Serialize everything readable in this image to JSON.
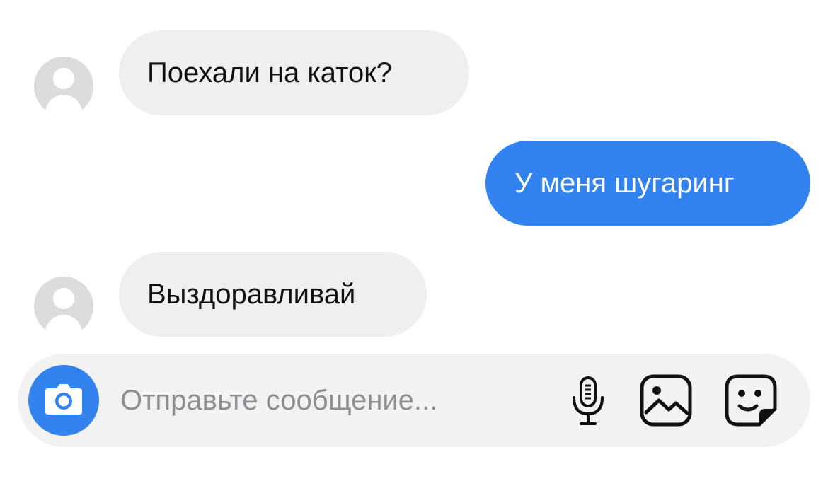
{
  "messages": [
    {
      "direction": "incoming",
      "text": "Поехали на каток?"
    },
    {
      "direction": "outgoing",
      "text": "У меня шугаринг"
    },
    {
      "direction": "incoming",
      "text": "Выздоравливай"
    }
  ],
  "composer": {
    "placeholder": "Отправьте сообщение...",
    "value": "",
    "icons": {
      "camera": "camera-icon",
      "microphone": "microphone-icon",
      "gallery": "image-icon",
      "sticker": "sticker-icon"
    }
  },
  "colors": {
    "incoming_bubble": "#efefef",
    "outgoing_bubble": "#3283ef",
    "camera_button": "#3383ee",
    "composer_background": "#f2f2f3",
    "placeholder_text": "#8e8e93",
    "avatar": "#dcdcdc"
  }
}
